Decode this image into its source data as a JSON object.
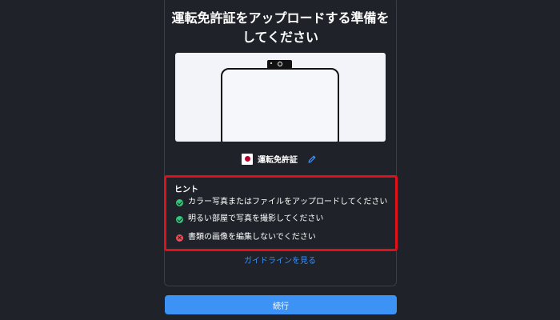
{
  "title": "運転免許証をアップロードする準備をしてください",
  "document": {
    "flag_icon": "japan-flag-icon",
    "label": "運転免許証",
    "edit_icon": "pencil-icon"
  },
  "hints": {
    "title": "ヒント",
    "items": [
      {
        "status": "ok",
        "icon": "check-circle-icon",
        "text": "カラー写真またはファイルをアップロードしてください"
      },
      {
        "status": "ok",
        "icon": "check-circle-icon",
        "text": "明るい部屋で写真を撮影してください"
      },
      {
        "status": "ng",
        "icon": "x-circle-icon",
        "text": "書類の画像を編集しないでください"
      }
    ]
  },
  "guide_link": "ガイドラインを見る",
  "continue_label": "続行",
  "colors": {
    "background": "#1f2228",
    "accent": "#3d93f5",
    "link": "#3e8ef0",
    "highlight_border": "#e0101a",
    "ok": "#34c77b",
    "ng": "#ef4d57"
  }
}
